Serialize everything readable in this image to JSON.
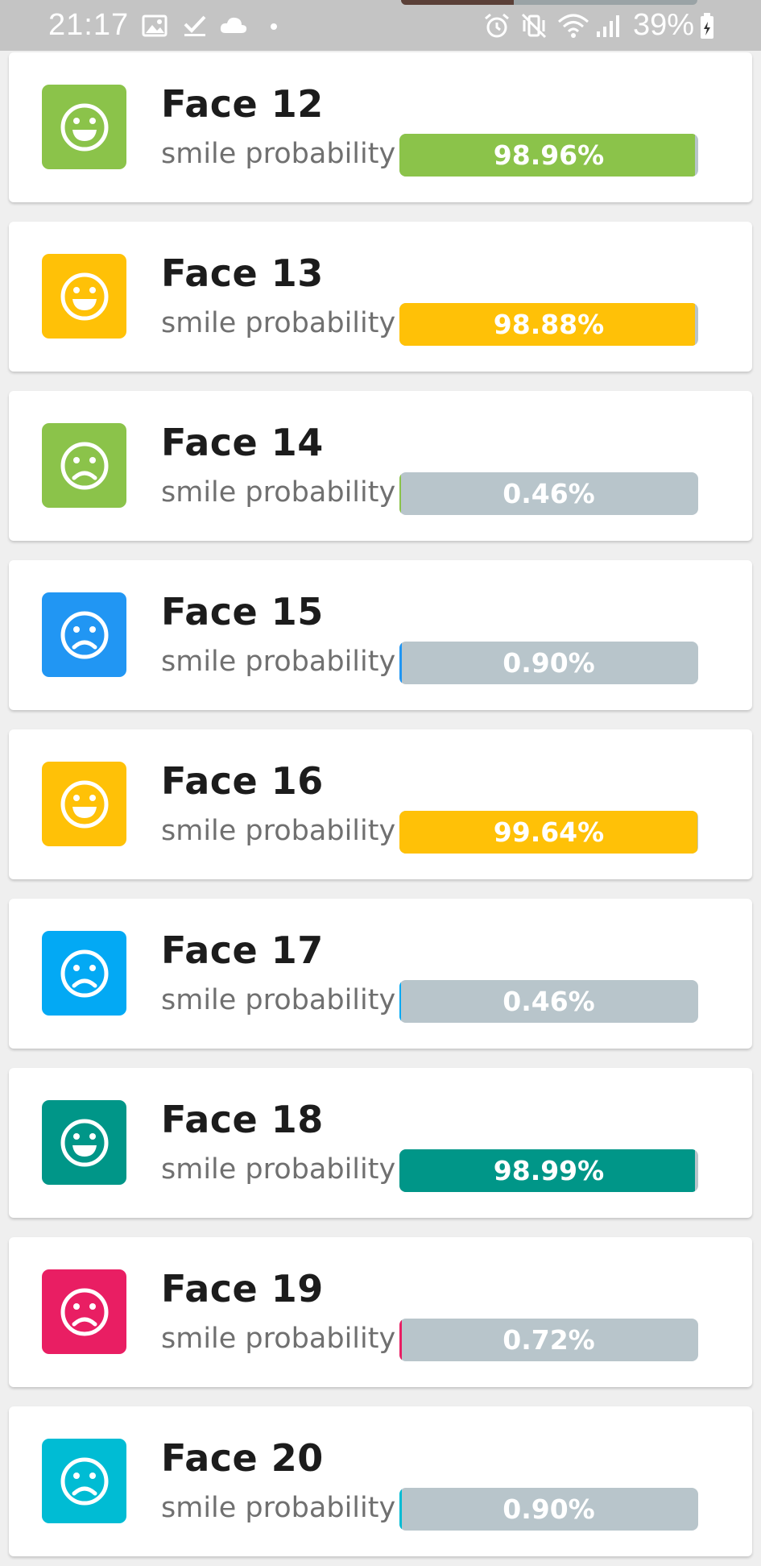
{
  "status_bar": {
    "time": "21:17",
    "battery": "39%",
    "icons": [
      "image-icon",
      "check-icon",
      "cloud-icon",
      "dot-icon",
      "alarm-icon",
      "vibrate-mute-icon",
      "wifi-icon",
      "signal-icon",
      "battery-charging-icon"
    ]
  },
  "subtitle_label": "smile probability",
  "faces": [
    {
      "title": "Face 12",
      "smiling": true,
      "color": "#8bc34a",
      "probability": 98.96,
      "label": "98.96%"
    },
    {
      "title": "Face 13",
      "smiling": true,
      "color": "#ffc107",
      "probability": 98.88,
      "label": "98.88%"
    },
    {
      "title": "Face 14",
      "smiling": false,
      "color": "#8bc34a",
      "probability": 0.46,
      "label": "0.46%"
    },
    {
      "title": "Face 15",
      "smiling": false,
      "color": "#2196f3",
      "probability": 0.9,
      "label": "0.90%"
    },
    {
      "title": "Face 16",
      "smiling": true,
      "color": "#ffc107",
      "probability": 99.64,
      "label": "99.64%"
    },
    {
      "title": "Face 17",
      "smiling": false,
      "color": "#03a9f4",
      "probability": 0.46,
      "label": "0.46%"
    },
    {
      "title": "Face 18",
      "smiling": true,
      "color": "#009688",
      "probability": 98.99,
      "label": "98.99%"
    },
    {
      "title": "Face 19",
      "smiling": false,
      "color": "#e91e63",
      "probability": 0.72,
      "label": "0.72%"
    },
    {
      "title": "Face 20",
      "smiling": false,
      "color": "#00bcd4",
      "probability": 0.9,
      "label": "0.90%"
    }
  ]
}
